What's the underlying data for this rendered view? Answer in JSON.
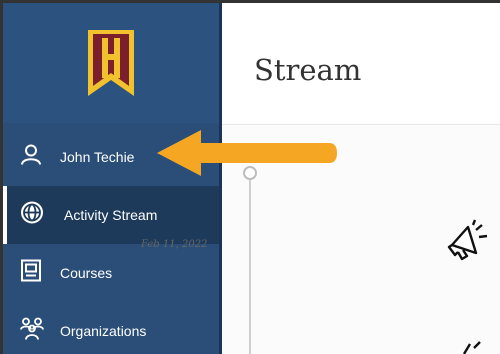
{
  "header": {
    "title": "Stream"
  },
  "sidebar": {
    "logo_icon": "institution-banner-logo",
    "items": [
      {
        "label": "John Techie",
        "icon": "user-icon"
      },
      {
        "label": "Activity Stream",
        "icon": "globe-icon",
        "active": true
      },
      {
        "label": "Courses",
        "icon": "courses-icon"
      },
      {
        "label": "Organizations",
        "icon": "organizations-icon"
      }
    ]
  },
  "stream": {
    "entries": [
      {
        "date": "Feb 11, 2022",
        "icon": "megaphone-icon"
      }
    ]
  },
  "annotation": {
    "icon": "arrow-pointer",
    "color": "#f5a623"
  },
  "colors": {
    "sidebar": "#2a4e78",
    "active_item": "#1d3a5a",
    "logo_red": "#7a1f2b",
    "logo_gold": "#f2c12e",
    "arrow": "#f5a623"
  }
}
